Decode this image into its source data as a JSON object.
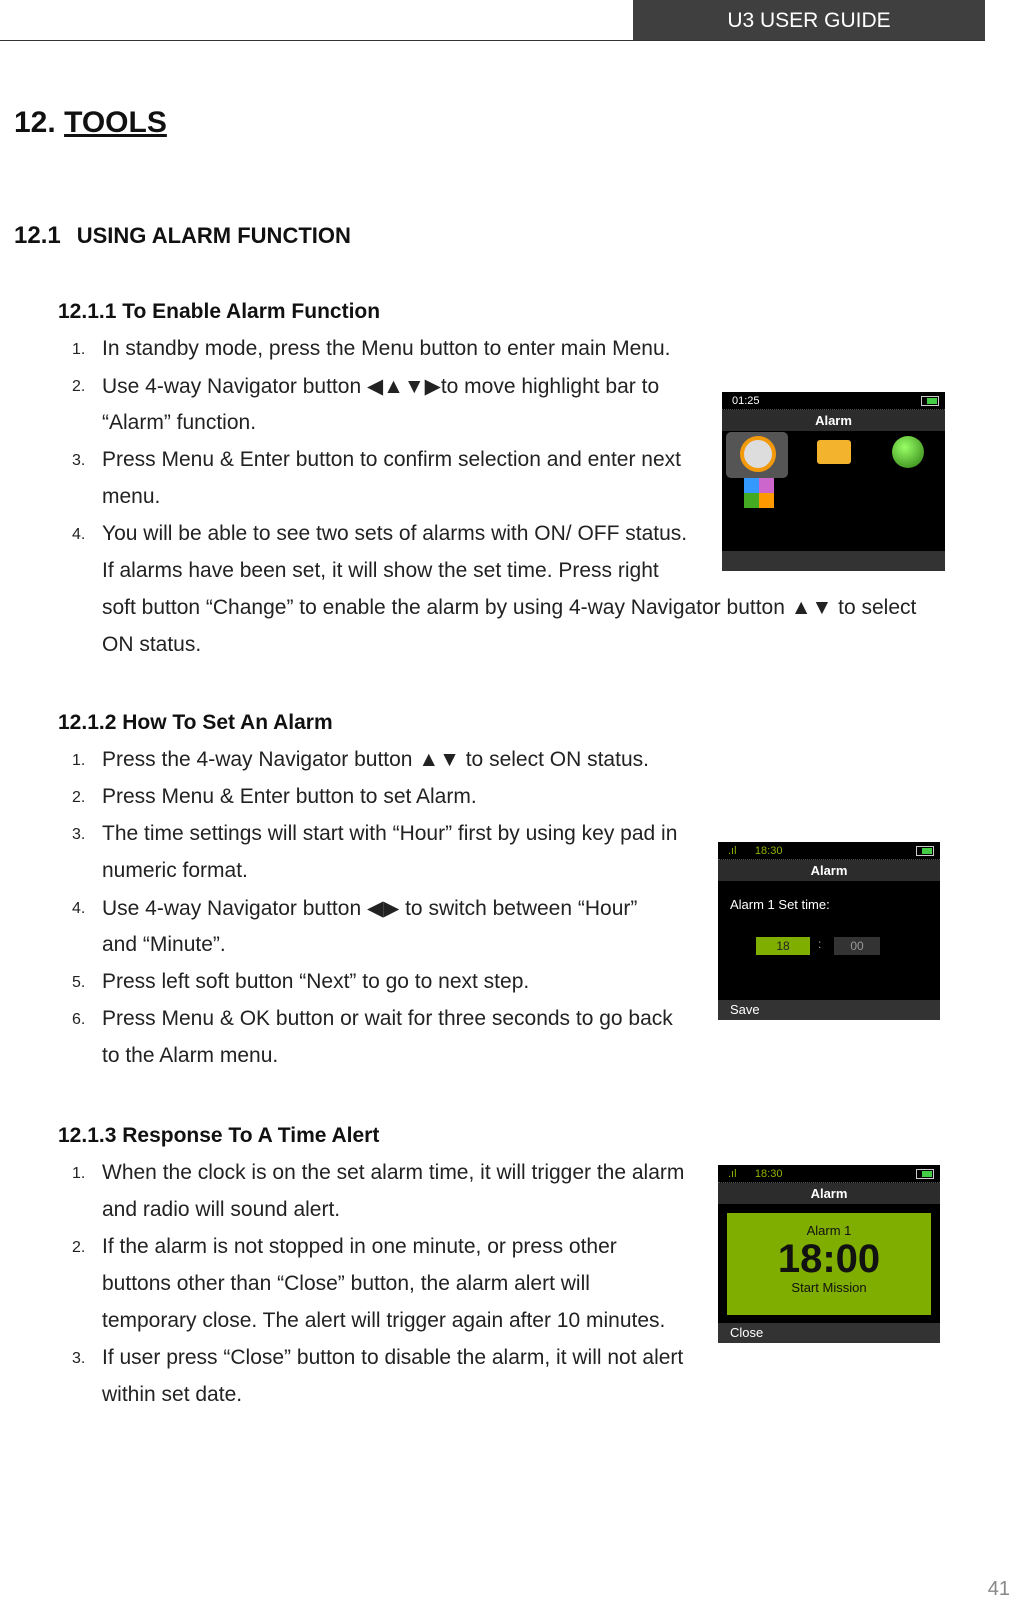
{
  "header": {
    "title": "U3 USER GUIDE"
  },
  "chapter": {
    "number": "12.",
    "title": "TOOLS"
  },
  "section": {
    "number": "12.1",
    "title": "USING ALARM FUNCTION"
  },
  "subsections": [
    {
      "title": "12.1.1  To Enable Alarm Function",
      "items": [
        {
          "num": "1.",
          "lines": [
            "In standby mode, press the Menu button to enter main Menu."
          ]
        },
        {
          "num": "2.",
          "lines": [
            "Use 4-way Navigator button ◀▲▼▶to move highlight bar to",
            "“Alarm” function."
          ]
        },
        {
          "num": "3.",
          "lines": [
            "Press Menu & Enter button to confirm selection and enter next",
            "menu."
          ]
        },
        {
          "num": "4.",
          "lines": [
            "You will be able to see two sets of alarms with ON/ OFF status.",
            "If alarms have been set, it will show the set time. Press right",
            "soft button “Change” to enable the alarm by using 4-way Navigator button ▲▼ to select",
            "ON status."
          ]
        }
      ]
    },
    {
      "title": "12.1.2  How To Set An Alarm",
      "items": [
        {
          "num": "1.",
          "lines": [
            "Press the 4-way Navigator button ▲▼ to select ON status."
          ]
        },
        {
          "num": "2.",
          "lines": [
            "Press Menu & Enter button to set Alarm."
          ]
        },
        {
          "num": "3.",
          "lines": [
            "The time settings will start with “Hour” first by using key pad in",
            "numeric format."
          ]
        },
        {
          "num": "4.",
          "lines": [
            "Use 4-way Navigator button ◀▶ to switch between “Hour”",
            "and “Minute”."
          ]
        },
        {
          "num": "5.",
          "lines": [
            "Press left soft button “Next” to go to next step."
          ]
        },
        {
          "num": "6.",
          "lines": [
            "Press Menu & OK button or wait for three seconds to go back",
            "to the Alarm menu."
          ]
        }
      ]
    },
    {
      "title": "12.1.3  Response To A Time Alert",
      "items": [
        {
          "num": "1.",
          "lines": [
            "When the clock is on the set alarm time, it will trigger the alarm",
            "and radio will sound alert."
          ]
        },
        {
          "num": "2.",
          "lines": [
            "If the alarm is not stopped in one minute, or press other",
            "buttons other than “Close” button, the alarm alert will",
            "temporary close. The alert will trigger again after 10 minutes."
          ]
        },
        {
          "num": "3.",
          "lines": [
            "If user press “Close” button to disable the alarm, it will not alert",
            "within set date."
          ]
        }
      ]
    }
  ],
  "screens": {
    "menu": {
      "time": "01:25",
      "title": "Alarm",
      "icons": [
        "alarm-clock-icon",
        "folder-edit-icon",
        "globe-icon",
        "apps-icon"
      ]
    },
    "set": {
      "time": "18:30",
      "title": "Alarm",
      "label": "Alarm 1  Set time:",
      "hour": "18",
      "sep": ":",
      "minute": "00",
      "softkey": "Save"
    },
    "alert": {
      "time": "18:30",
      "title": "Alarm",
      "label": "Alarm 1",
      "clock": "18:00",
      "sub": "Start  Mission",
      "softkey": "Close"
    }
  },
  "colors": {
    "accent": "#7fad00",
    "header_bg": "#3f3f3f"
  },
  "page_number": "41"
}
